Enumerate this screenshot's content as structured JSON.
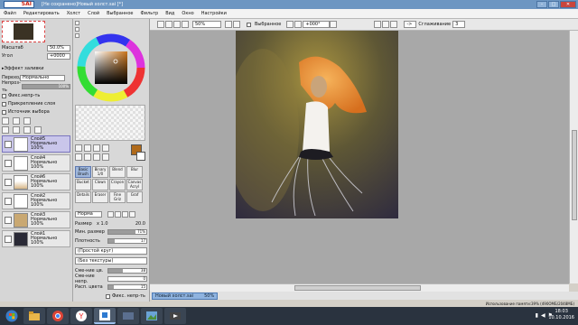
{
  "titlebar": {
    "logo": "SAI",
    "title": "[Не сохранено]Новый холст.sai [*]",
    "min": "–",
    "max": "□",
    "close": "✕"
  },
  "menu": [
    "Файл",
    "Редактировать",
    "Холст",
    "Слой",
    "Выбранное",
    "Фильтр",
    "Вид",
    "Окно",
    "Настройки"
  ],
  "toolbar": {
    "zoom": "50%",
    "selection_label": "Выбранное",
    "angle": "+000°",
    "arrow": "->",
    "smoothing_label": "Сглаживание",
    "smoothing_value": "3"
  },
  "nav": {
    "scale_label": "Масштаб",
    "scale_value": "50.0%",
    "angle_label": "Угол",
    "angle_value": "+0000"
  },
  "layer_props": {
    "effect_label": "Эффект заливки",
    "mode_label": "Переход",
    "mode_value": "Нормально",
    "opacity_label": "Непроз-ть",
    "opacity_value": "100%",
    "opacity_fraction": 1.0,
    "checks": [
      "Фикс.непр-ть",
      "Прикрепление слоя",
      "Источник выбора"
    ]
  },
  "layers": [
    {
      "name": "Слой5",
      "mode": "Нормально",
      "opacity": "100%",
      "selected": true
    },
    {
      "name": "Слой4",
      "mode": "Нормально",
      "opacity": "100%",
      "selected": false
    },
    {
      "name": "Слой6",
      "mode": "Нормально",
      "opacity": "100%",
      "selected": false
    },
    {
      "name": "Слой2",
      "mode": "Нормально",
      "opacity": "100%",
      "selected": false
    },
    {
      "name": "Слой3",
      "mode": "Нормально",
      "opacity": "100%",
      "selected": false
    },
    {
      "name": "Слой1",
      "mode": "Нормально",
      "opacity": "100%",
      "selected": false
    }
  ],
  "colors": {
    "primary": "#b06a1a",
    "secondary": "#ffffff",
    "selection": "#c9c6ea"
  },
  "tools": [
    {
      "label": "Basic Brush",
      "selected": true
    },
    {
      "label": "Binary 1/0",
      "selected": false
    },
    {
      "label": "Blend",
      "selected": false
    },
    {
      "label": "Blur",
      "selected": false
    },
    {
      "label": "Bucket",
      "selected": false
    },
    {
      "label": "Clown",
      "selected": false
    },
    {
      "label": "Crayon",
      "selected": false
    },
    {
      "label": "Canvas Acryl",
      "selected": false
    },
    {
      "label": "Details",
      "selected": false
    },
    {
      "label": "Eraser",
      "selected": false
    },
    {
      "label": "Fine Griz",
      "selected": false
    },
    {
      "label": "Graf",
      "selected": false
    }
  ],
  "brush": {
    "mode": "Норма",
    "size_label": "Размер",
    "size_mult": "x 1.0",
    "size_value": "20.0",
    "min_size_label": "Мин. размер",
    "min_size_value": "71%",
    "min_size_fraction": 0.71,
    "density_label": "Плотность",
    "density_value": "17",
    "density_fraction": 0.17,
    "shape": "(Простой круг)",
    "texture": "(Без текстуры)",
    "blend_label": "Сме-ние цв.",
    "blend_value": "38",
    "blend_fraction": 0.38,
    "dilution_label": "Сме-ние непр.",
    "dilution_value": "0",
    "dilution_fraction": 0.0,
    "persistence_label": "Расп. цвета",
    "persistence_value": "15",
    "persistence_fraction": 0.15,
    "keep_opacity": "Фикс. непр-ть"
  },
  "doc_tab": {
    "name": "Новый холст.sai",
    "zoom": "50%"
  },
  "status": "Использование памяти:39% (490ОМБ/2048МБ)",
  "clock": {
    "time": "18:03",
    "date": "10.10.2016"
  },
  "taskbar": [
    "start-icon",
    "folder-icon",
    "chrome-icon",
    "yandex-icon",
    "sai-icon",
    "app-icon",
    "photos-icon",
    "video-icon"
  ]
}
